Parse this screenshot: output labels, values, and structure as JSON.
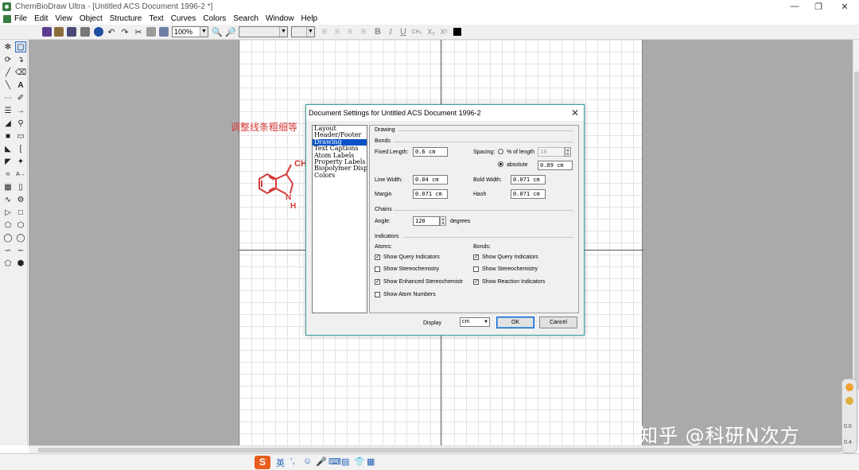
{
  "app": {
    "title": "ChemBioDraw Ultra - [Untitled ACS Document 1996-2 *]"
  },
  "window_controls": {
    "minimize": "—",
    "restore": "❐",
    "close": "✕"
  },
  "menu": [
    "File",
    "Edit",
    "View",
    "Object",
    "Structure",
    "Text",
    "Curves",
    "Colors",
    "Search",
    "Window",
    "Help"
  ],
  "toolbar": {
    "zoom_value": "100%",
    "font_value": "",
    "size_value": "",
    "bold_label": "B",
    "italic_label": "I",
    "underline_label": "U",
    "formula_label": "CH₂",
    "subscript_label": "X₂",
    "superscript_label": "X²"
  },
  "palette": {
    "text_tool_label": "A"
  },
  "annotation": {
    "text": "调整线条粗细等",
    "color": "#d63a3a"
  },
  "molecule": {
    "label_top": "CH",
    "label_n": "N",
    "label_h": "H",
    "color": "#d63a3a"
  },
  "watermark": {
    "text": "知乎 @科研N次方"
  },
  "side_widget": {
    "value_a": "0.0",
    "value_b": "0.4"
  },
  "dialog": {
    "title": "Document Settings for Untitled ACS Document 1996-2",
    "categories": [
      "Layout",
      "Header/Footer",
      "Drawing",
      "Text Captions",
      "Atom Labels",
      "Property Labels",
      "Biopolymer Disp",
      "Colors"
    ],
    "selected_category": "Drawing",
    "section_drawing": "Drawing",
    "section_bonds": "Bonds",
    "fixed_length_label": "Fixed Length:",
    "fixed_length_value": "0.6 cm",
    "spacing_label": "Spacing:",
    "percent_label": "% of length",
    "percent_value": "18",
    "absolute_label": "absolute",
    "absolute_value": "0.09 cm",
    "line_width_label": "Line Width:",
    "line_width_value": "0.04 cm",
    "bold_width_label": "Bold Width:",
    "bold_width_value": "0.071 cm",
    "margin_label": "Margin",
    "margin_value": "0.071 cm",
    "hash_label": "Hash",
    "hash_value": "0.071 cm",
    "section_chains": "Chains",
    "angle_label": "Angle:",
    "angle_value": "120",
    "degrees_label": "degrees",
    "section_indicators": "Indicators",
    "atoms_label": "Atoms:",
    "bonds_label": "Bonds:",
    "atom_indicators": [
      {
        "label": "Show Query Indicators",
        "checked": true
      },
      {
        "label": "Show Stereochemistry",
        "checked": false
      },
      {
        "label": "Show Enhanced Stereochemistr",
        "checked": true
      },
      {
        "label": "Show Atom Numbers",
        "checked": false
      }
    ],
    "bond_indicators": [
      {
        "label": "Show Query Indicators",
        "checked": true
      },
      {
        "label": "Show Stereochemistry",
        "checked": false
      },
      {
        "label": "Show Reaction Indicators",
        "checked": true
      }
    ],
    "display_label": "Display",
    "display_value": "cm",
    "ok_label": "OK",
    "cancel_label": "Cancel"
  },
  "taskbar": {
    "ime_label": "英",
    "ime_logo": "S"
  }
}
